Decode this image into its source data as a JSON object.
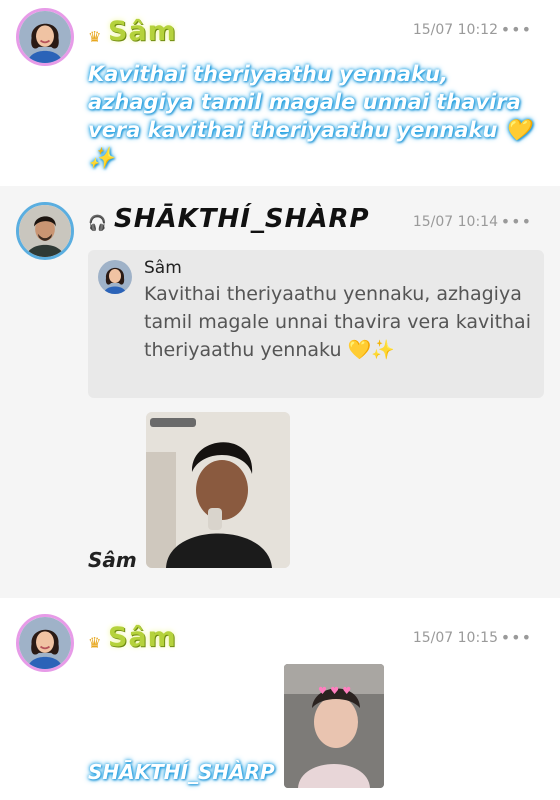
{
  "posts": [
    {
      "author": "Sâm",
      "author_badge": "crown-icon",
      "time": "15/07 10:12",
      "more": "•••",
      "message": "Kavithai theriyaathu yennaku, azhagiya tamil magale unnai thavira vera kavithai theriyaathu yennaku 💛✨"
    },
    {
      "author": "SHĀKTHÍ_SHÀRP",
      "author_badge": "headphones-icon",
      "time": "15/07 10:14",
      "more": "•••",
      "quote": {
        "author": "Sâm",
        "text": "Kavithai theriyaathu yennaku, azhagiya tamil magale unnai thavira vera kavithai theriyaathu yennaku 💛✨"
      },
      "image_caption": "Sâm"
    },
    {
      "author": "Sâm",
      "author_badge": "crown-icon",
      "time": "15/07 10:15",
      "more": "•••",
      "image_caption": "SHĀKTHÍ_SHÀRP"
    }
  ],
  "colors": {
    "name_green": "#b5d23c",
    "glow_blue": "#27a6e6",
    "avatar_pink_ring": "#e79be8",
    "avatar_blue_ring": "#5aaee0",
    "timestamp_gray": "#9a9a9a"
  }
}
